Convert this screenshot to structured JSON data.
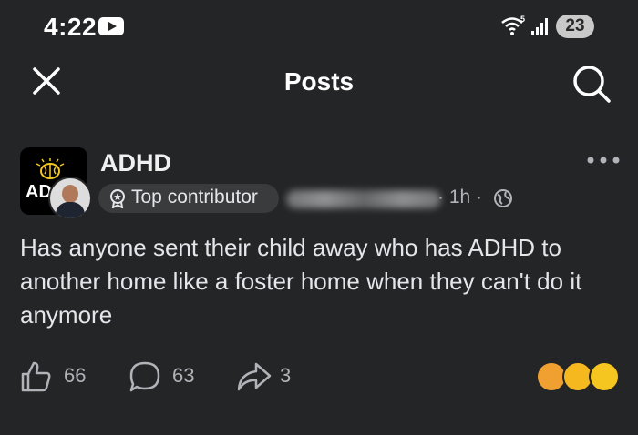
{
  "status_bar": {
    "time": "4:22",
    "network": "5",
    "battery": "23"
  },
  "header": {
    "title": "Posts"
  },
  "post": {
    "group_name": "ADHD",
    "group_avatar_text": "AD",
    "badge": "Top contributor",
    "time": "· 1h ·",
    "text": "Has anyone sent their  child away who has ADHD to another home like a  foster home when they can't do it anymore",
    "likes": "66",
    "comments": "63",
    "shares": "3"
  },
  "colors": {
    "background": "#242526",
    "text": "#e4e6eb",
    "secondary_text": "#b0b3b8",
    "badge_bg": "#3a3b3c"
  },
  "icons": [
    "youtube-icon",
    "wifi-icon",
    "signal-icon",
    "close-icon",
    "search-icon",
    "award-icon",
    "globe-icon",
    "more-icon",
    "like-icon",
    "comment-icon",
    "share-icon"
  ]
}
